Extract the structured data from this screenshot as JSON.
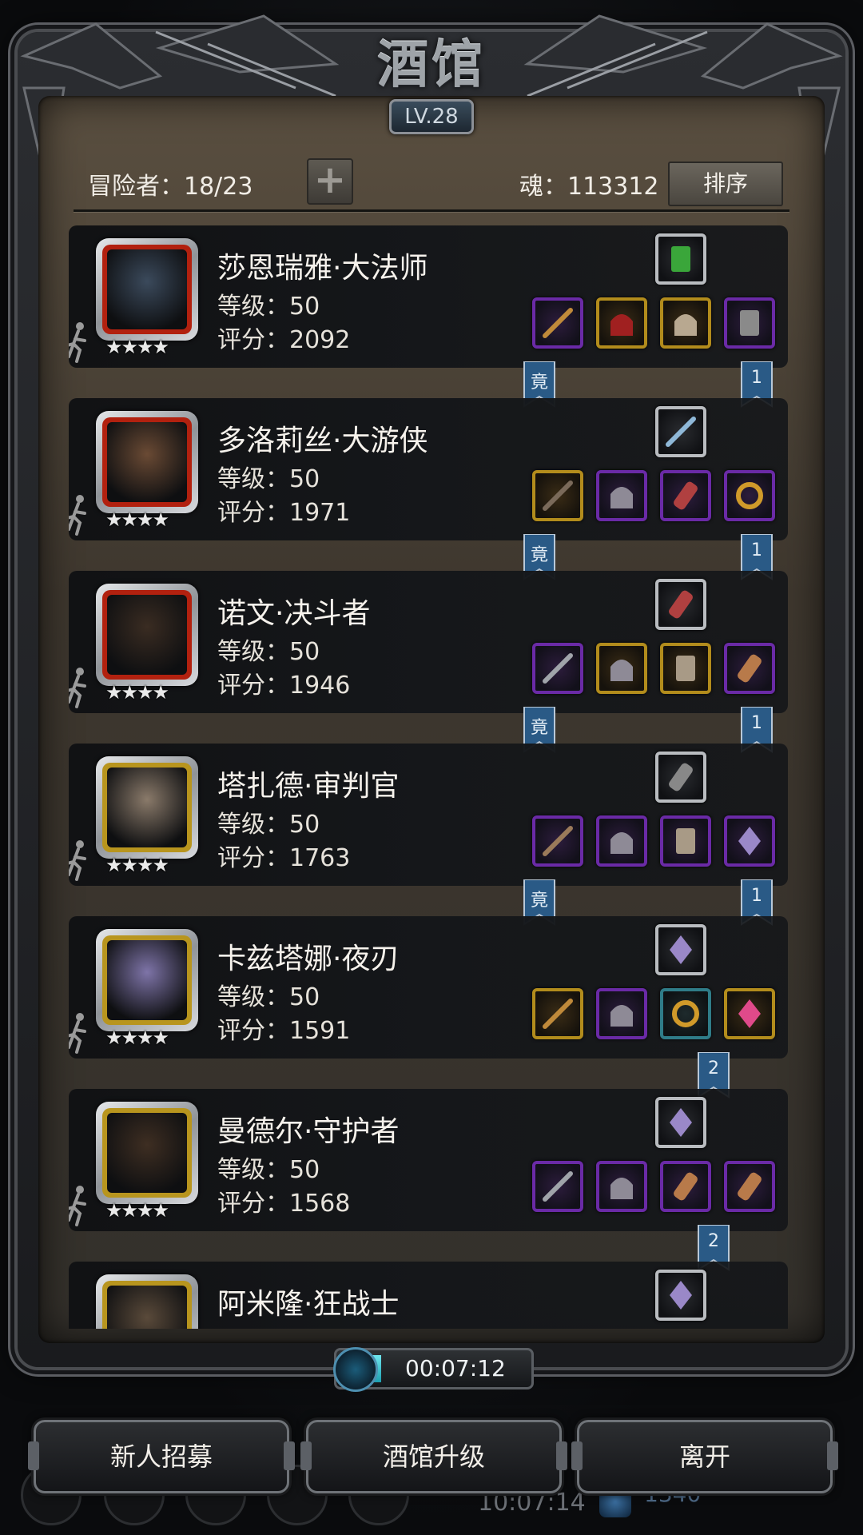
{
  "title": "酒馆",
  "level_badge": "LV.28",
  "header": {
    "adventurers": "冒险者：18/23",
    "plus": "+",
    "soul": "魂：113312",
    "sort": "排序"
  },
  "heroes": [
    {
      "name": "莎恩瑞雅·大法师",
      "level": "等级：50",
      "score": "评分：2092",
      "stars": "★★★★",
      "frame": "red",
      "top_item": {
        "color": "white",
        "icon": "green-tome"
      },
      "items": [
        {
          "color": "purple",
          "icon": "staff"
        },
        {
          "color": "gold",
          "icon": "red-hood"
        },
        {
          "color": "gold",
          "icon": "mask"
        },
        {
          "color": "purple",
          "icon": "boots"
        }
      ],
      "left_ribbon": "竟",
      "right_ribbon": "1"
    },
    {
      "name": "多洛莉丝·大游侠",
      "level": "等级：50",
      "score": "评分：1971",
      "stars": "★★★★",
      "frame": "red",
      "top_item": {
        "color": "white",
        "icon": "necklace"
      },
      "items": [
        {
          "color": "gold",
          "icon": "rifle"
        },
        {
          "color": "purple",
          "icon": "armor"
        },
        {
          "color": "purple",
          "icon": "bracer"
        },
        {
          "color": "purple",
          "icon": "ring"
        }
      ],
      "left_ribbon": "竟",
      "right_ribbon": "1"
    },
    {
      "name": "诺文·决斗者",
      "level": "等级：50",
      "score": "评分：1946",
      "stars": "★★★★",
      "frame": "red",
      "top_item": {
        "color": "white",
        "icon": "bracer"
      },
      "items": [
        {
          "color": "purple",
          "icon": "sword"
        },
        {
          "color": "gold",
          "icon": "armor"
        },
        {
          "color": "gold",
          "icon": "gauntlet"
        },
        {
          "color": "purple",
          "icon": "wood"
        }
      ],
      "left_ribbon": "竟",
      "right_ribbon": "1"
    },
    {
      "name": "塔扎德·审判官",
      "level": "等级：50",
      "score": "评分：1763",
      "stars": "★★★★",
      "frame": "gold",
      "top_item": {
        "color": "white",
        "icon": "claw"
      },
      "items": [
        {
          "color": "purple",
          "icon": "hammer"
        },
        {
          "color": "purple",
          "icon": "armor"
        },
        {
          "color": "purple",
          "icon": "gauntlet"
        },
        {
          "color": "purple",
          "icon": "crystal"
        }
      ],
      "left_ribbon": "竟",
      "right_ribbon": "1"
    },
    {
      "name": "卡兹塔娜·夜刃",
      "level": "等级：50",
      "score": "评分：1591",
      "stars": "★★★★",
      "frame": "gold",
      "top_item": {
        "color": "white",
        "icon": "crystal"
      },
      "items": [
        {
          "color": "gold",
          "icon": "staff"
        },
        {
          "color": "purple",
          "icon": "armor"
        },
        {
          "color": "teal",
          "icon": "ring"
        },
        {
          "color": "gold",
          "icon": "amulet"
        }
      ],
      "left_ribbon": "",
      "right_ribbon": "2"
    },
    {
      "name": "曼德尔·守护者",
      "level": "等级：50",
      "score": "评分：1568",
      "stars": "★★★★",
      "frame": "gold",
      "top_item": {
        "color": "white",
        "icon": "crystal"
      },
      "items": [
        {
          "color": "purple",
          "icon": "sword"
        },
        {
          "color": "purple",
          "icon": "armor"
        },
        {
          "color": "purple",
          "icon": "wood"
        },
        {
          "color": "purple",
          "icon": "wood"
        }
      ],
      "left_ribbon": "",
      "right_ribbon": "2"
    },
    {
      "name": "阿米隆·狂战士",
      "level": "",
      "score": "",
      "stars": "",
      "frame": "gold",
      "top_item": {
        "color": "white",
        "icon": "crystal"
      },
      "items": [],
      "left_ribbon": "",
      "right_ribbon": ""
    }
  ],
  "timer": "00:07:12",
  "buttons": {
    "recruit": "新人招募",
    "upgrade": "酒馆升级",
    "leave": "离开"
  },
  "background": {
    "clock": "10:07:14",
    "gem_count": "1340"
  },
  "colors": {
    "purple_frame": "#6a2aa6",
    "gold_frame": "#b28c1c",
    "red_portrait": "#b2210f",
    "gold_portrait": "#b8951e",
    "ribbon": "#2a5a86"
  }
}
